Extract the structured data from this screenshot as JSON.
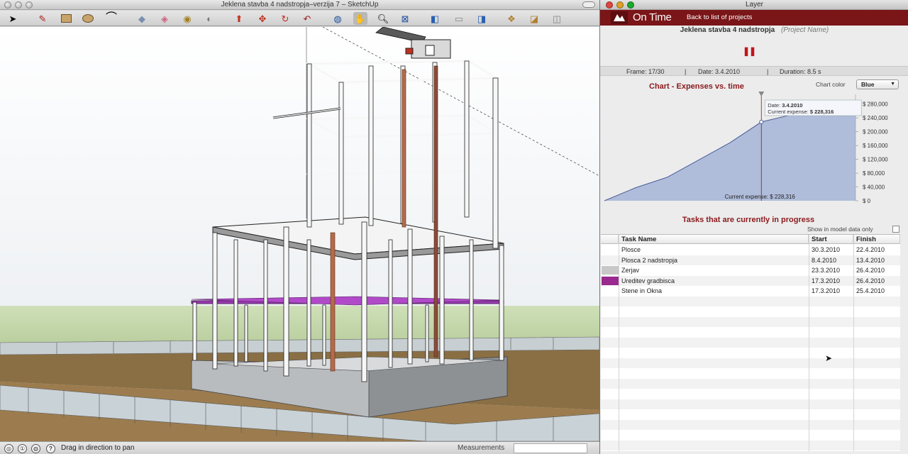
{
  "sketchup": {
    "title": "Jeklena stavba 4 nadstropja–verzija 7 – SketchUp",
    "toolbar": [
      "select-tool",
      "pencil-tool",
      "rectangle-tool",
      "circle-tool",
      "arc-tool",
      "eraser-tool",
      "paint-tool",
      "tape-tool",
      "protractor-tool",
      "pushpull-tool",
      "move-tool",
      "rotate-tool",
      "followme-tool",
      "orbit-tool",
      "pan-tool",
      "zoom-tool",
      "zoom-extents-tool",
      "previous-view-tool",
      "next-view-tool",
      "walk-tool",
      "components-tool",
      "warehouse-tool"
    ],
    "status_text": "Drag in direction to pan",
    "measurements_label": "Measurements"
  },
  "layer_window": {
    "title": "Layer"
  },
  "ontime": {
    "app_name": "On Time",
    "back_link": "Back to list of projects",
    "project_name": "Jeklena stavba 4 nadstropja",
    "project_name_label": "(Project Name)",
    "frame": "Frame: 17/30",
    "date": "Date: 3.4.2010",
    "duration": "Duration: 8.5 s",
    "chart_color_label": "Chart color",
    "chart_color_value": "Blue",
    "tasks_title": "Tasks that are currently in progress",
    "show_model_label": "Show in model data only",
    "table_headers": [
      "Task Name",
      "Start",
      "Finish"
    ],
    "tasks": [
      {
        "name": "Plosce",
        "start": "30.3.2010",
        "finish": "22.4.2010",
        "color": ""
      },
      {
        "name": "Plosca 2 nadstropja",
        "start": "8.4.2010",
        "finish": "13.4.2010",
        "color": ""
      },
      {
        "name": "Zerjav",
        "start": "23.3.2010",
        "finish": "26.4.2010",
        "color": "#c8c8c8"
      },
      {
        "name": "Ureditev gradbisca",
        "start": "17.3.2010",
        "finish": "26.4.2010",
        "color": "#9a2a8f"
      },
      {
        "name": "Stene in Okna",
        "start": "17.3.2010",
        "finish": "25.4.2010",
        "color": ""
      }
    ]
  },
  "chart_data": {
    "type": "area",
    "title": "Chart - Expenses vs. time",
    "xlabel": "",
    "ylabel": "",
    "ylim": [
      0,
      300000
    ],
    "y_ticks": [
      "$ 280,000",
      "$ 240,000",
      "$ 200,000",
      "$ 160,000",
      "$ 120,000",
      "$ 80,000",
      "$ 40,000",
      "$ 0"
    ],
    "y_tick_values": [
      280000,
      240000,
      200000,
      160000,
      120000,
      80000,
      40000,
      0
    ],
    "series": [
      {
        "values": [
          0,
          38000,
          68000,
          118000,
          168000,
          228316,
          250000,
          280000,
          290000
        ]
      }
    ],
    "x": [
      0,
      1,
      2,
      3,
      4,
      5,
      6,
      7,
      8
    ],
    "marker": {
      "x": 5,
      "date_label": "Date:",
      "date": "3.4.2010",
      "expense_label": "Current expense:",
      "expense": "$ 228,316"
    },
    "footer": "Current expense: $ 228,316",
    "color": "#a9b7d8"
  }
}
